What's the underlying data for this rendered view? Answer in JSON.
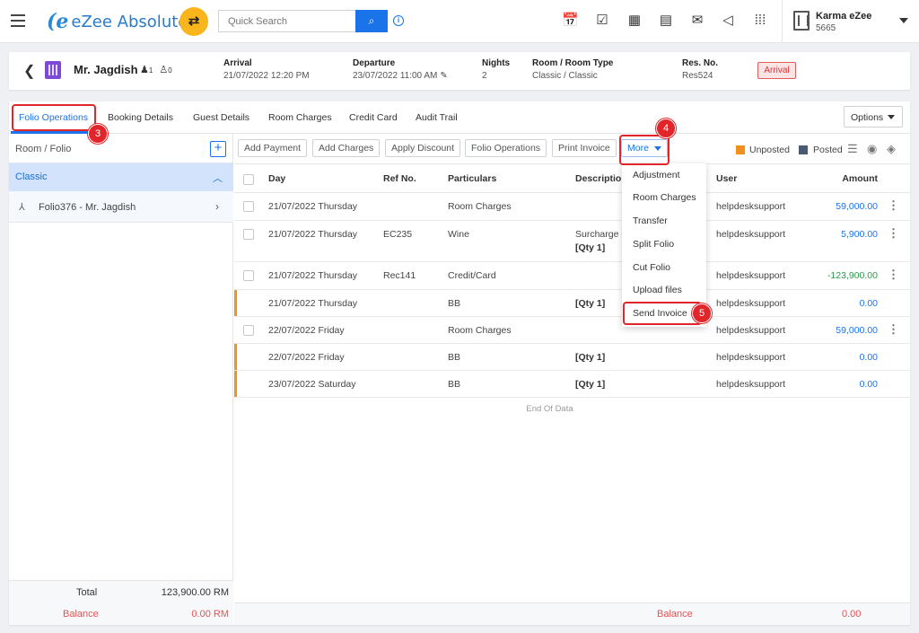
{
  "topbar": {
    "logo_text": "eZee Absolute",
    "search_placeholder": "Quick Search",
    "hotel_name": "Karma eZee",
    "hotel_code": "5665"
  },
  "reservation": {
    "guest_name": "Mr. Jagdish",
    "adults": "1",
    "children": "0",
    "arrival_label": "Arrival",
    "arrival_value": "21/07/2022 12:20 PM",
    "departure_label": "Departure",
    "departure_value": "23/07/2022 11:00 AM",
    "nights_label": "Nights",
    "nights_value": "2",
    "room_type_label": "Room / Room Type",
    "room_type_value": "Classic / Classic",
    "res_no_label": "Res. No.",
    "res_no_value": "Res524",
    "status": "Arrival"
  },
  "tabs": [
    "Folio Operations",
    "Booking Details",
    "Guest Details",
    "Room Charges",
    "Credit Card",
    "Audit Trail"
  ],
  "options_label": "Options",
  "left_panel": {
    "title": "Room / Folio",
    "group": "Classic",
    "folio": "Folio376 - Mr. Jagdish",
    "total_label": "Total",
    "total_value": "123,900.00 RM",
    "balance_label": "Balance",
    "balance_value": "0.00 RM"
  },
  "actions": [
    "Add Payment",
    "Add Charges",
    "Apply Discount",
    "Folio Operations",
    "Print Invoice",
    "More"
  ],
  "legend": {
    "unposted": "Unposted",
    "posted": "Posted",
    "unposted_color": "#f0901e",
    "posted_color": "#4a5a75"
  },
  "table": {
    "headers": [
      "Day",
      "Ref No.",
      "Particulars",
      "Description",
      "User",
      "Amount"
    ],
    "rows": [
      {
        "day": "21/07/2022 Thursday",
        "ref": "",
        "particulars": "Room Charges",
        "description": "",
        "qty": "",
        "user": "helpdesksupport",
        "amount": "59,000.00"
      },
      {
        "day": "21/07/2022 Thursday",
        "ref": "EC235",
        "particulars": "Wine",
        "description": "Surcharge o",
        "qty": "[Qty 1]",
        "user": "helpdesksupport",
        "amount": "5,900.00"
      },
      {
        "day": "21/07/2022 Thursday",
        "ref": "Rec141",
        "particulars": "Credit/Card",
        "description": "",
        "qty": "",
        "user": "helpdesksupport",
        "amount": "-123,900.00"
      },
      {
        "day": "21/07/2022 Thursday",
        "ref": "",
        "particulars": "BB",
        "description": "",
        "qty": "[Qty 1]",
        "user": "helpdesksupport",
        "amount": "0.00"
      },
      {
        "day": "22/07/2022 Friday",
        "ref": "",
        "particulars": "Room Charges",
        "description": "",
        "qty": "",
        "user": "helpdesksupport",
        "amount": "59,000.00"
      },
      {
        "day": "22/07/2022 Friday",
        "ref": "",
        "particulars": "BB",
        "description": "",
        "qty": "[Qty 1]",
        "user": "helpdesksupport",
        "amount": "0.00"
      },
      {
        "day": "23/07/2022 Saturday",
        "ref": "",
        "particulars": "BB",
        "description": "",
        "qty": "[Qty 1]",
        "user": "helpdesksupport",
        "amount": "0.00"
      }
    ],
    "end_text": "End Of Data",
    "balance_label": "Balance",
    "balance_value": "0.00"
  },
  "more_menu": [
    "Adjustment",
    "Room Charges",
    "Transfer",
    "Split Folio",
    "Cut Folio",
    "Upload files",
    "Send Invoice"
  ],
  "callouts": [
    "3",
    "4",
    "5"
  ]
}
